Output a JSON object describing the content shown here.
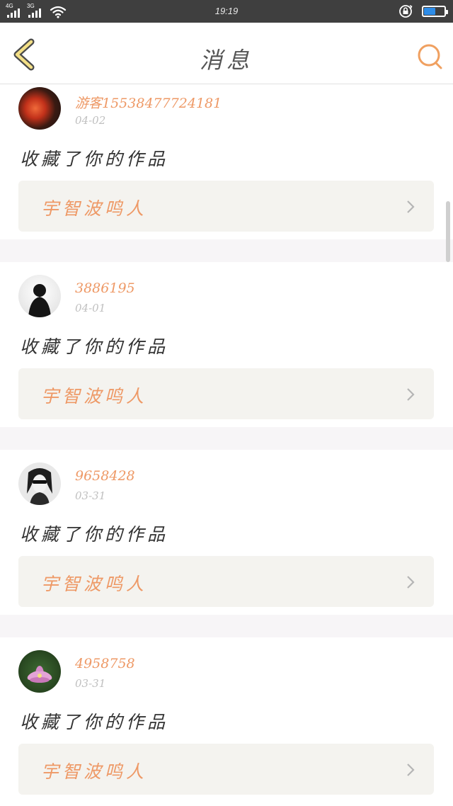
{
  "status_bar": {
    "network_1": "4G",
    "network_2": "3G",
    "time": "19:19",
    "battery_level": 0.6,
    "icons": [
      "signal-icon",
      "wifi-icon",
      "rotation-lock-icon",
      "battery-icon"
    ]
  },
  "nav": {
    "title": "消息",
    "back_icon": "chevron-left-icon",
    "search_icon": "search-icon",
    "accent_color": "#f0a060"
  },
  "messages": [
    {
      "username": "游客15538477724181",
      "date": "04-02",
      "action": "收藏了你的作品",
      "work_title": "宇智波鸣人",
      "avatar_colors": [
        "#c2311a",
        "#1a1410"
      ]
    },
    {
      "username": "3886195",
      "date": "04-01",
      "action": "收藏了你的作品",
      "work_title": "宇智波鸣人",
      "avatar_colors": [
        "#f0f0f0",
        "#151515"
      ]
    },
    {
      "username": "9658428",
      "date": "03-31",
      "action": "收藏了你的作品",
      "work_title": "宇智波鸣人",
      "avatar_colors": [
        "#e8e8e8",
        "#1e1e1e"
      ]
    },
    {
      "username": "4958758",
      "date": "03-31",
      "action": "收藏了你的作品",
      "work_title": "宇智波鸣人",
      "avatar_colors": [
        "#2a4a22",
        "#d68ac8"
      ]
    }
  ],
  "colors": {
    "username": "#ee9966",
    "date": "#c0c0c0",
    "link_bg": "#f4f3ef",
    "divider": "#f7f5f7"
  }
}
